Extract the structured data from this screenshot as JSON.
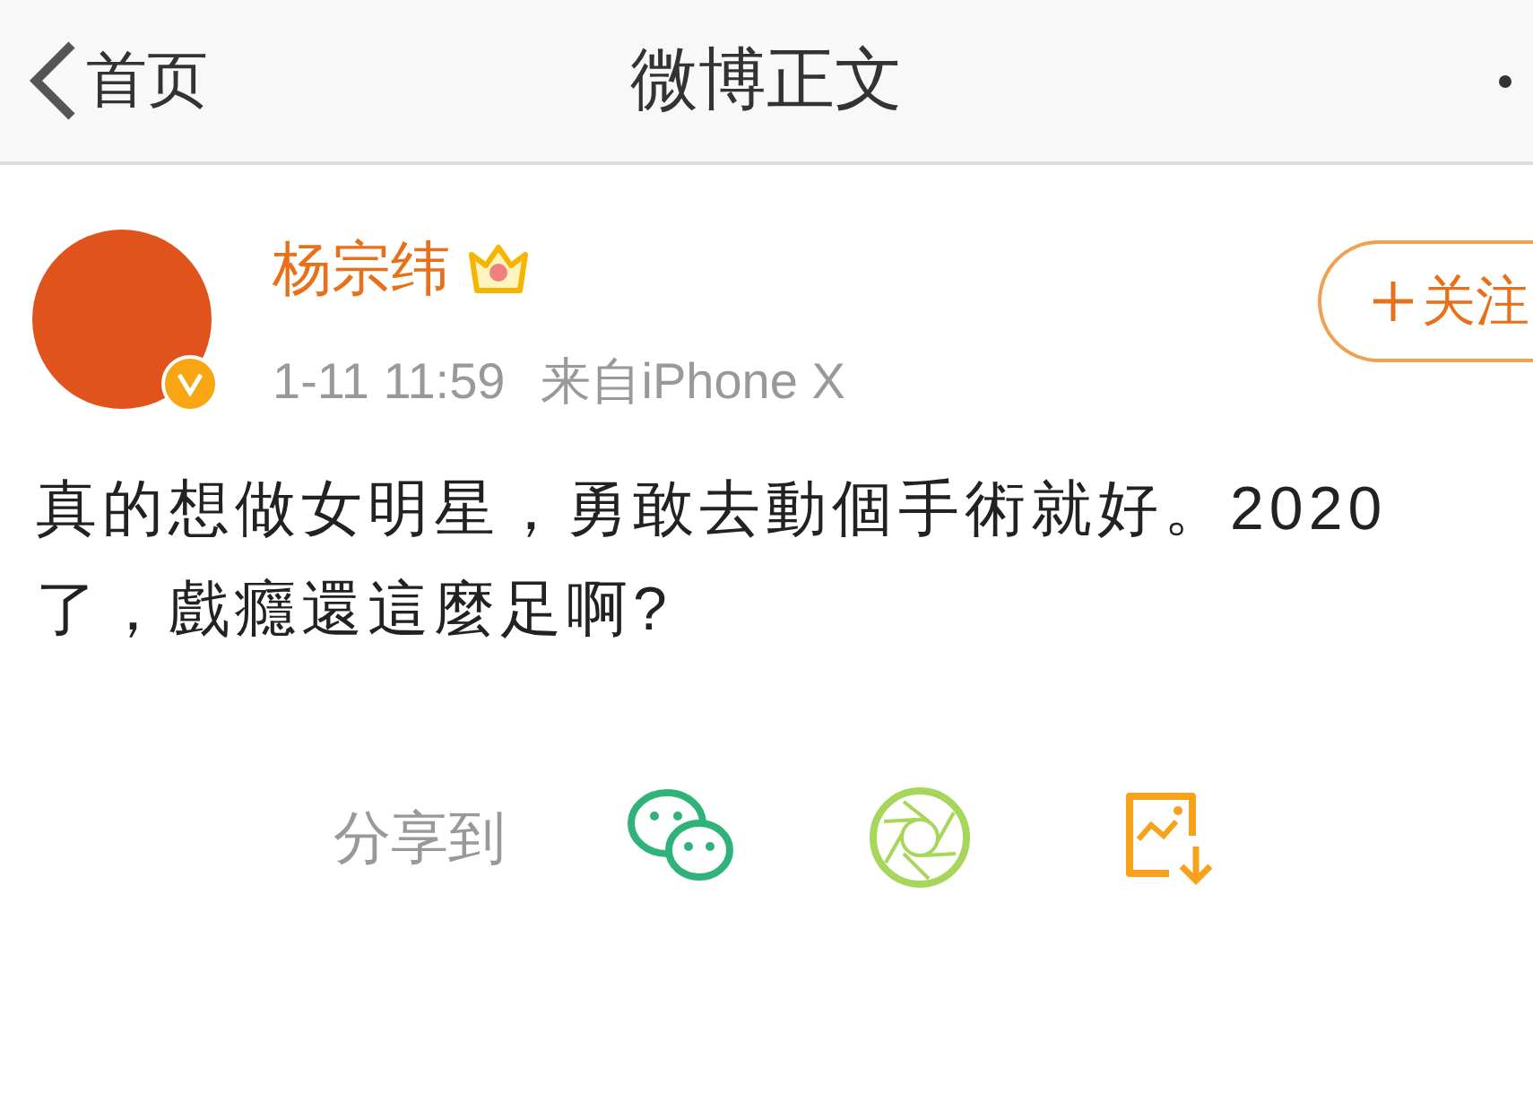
{
  "nav_bar": {
    "back_label": "首页",
    "title": "微博正文"
  },
  "post": {
    "author": "杨宗纬",
    "time": "1-11 11:59",
    "source": "来自iPhone X",
    "follow_label": "关注",
    "text": "真的想做女明星，勇敢去動個手術就好。2020了，戲癮還這麼足啊?"
  },
  "share": {
    "label": "分享到"
  }
}
